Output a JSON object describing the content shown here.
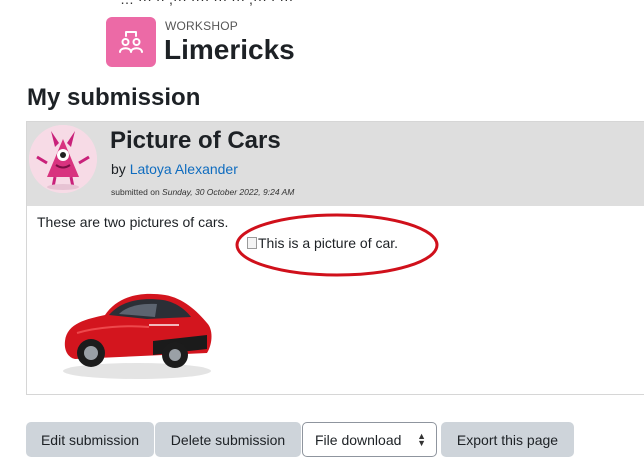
{
  "top_clip_text": "… ··· ·· ,··· ···· ··· ··· ,··· · ···",
  "activity": {
    "kicker": "WORKSHOP",
    "title": "Limericks",
    "icon": "workshop-icon",
    "icon_bg": "#ec6aa6"
  },
  "section_heading": "My submission",
  "submission": {
    "title": "Picture of Cars",
    "by_prefix": "by",
    "author": "Latoya Alexander",
    "submitted_prefix": "submitted on",
    "submitted_date": "Sunday, 30 October 2022, 9:24 AM",
    "text": "These are two pictures of cars.",
    "broken_image_alt": "This is a picture of car.",
    "annotation_color": "#d0101b",
    "link_color": "#0f6cbf"
  },
  "actions": {
    "edit_label": "Edit submission",
    "delete_label": "Delete submission",
    "select_value": "File download",
    "export_label": "Export this page"
  }
}
